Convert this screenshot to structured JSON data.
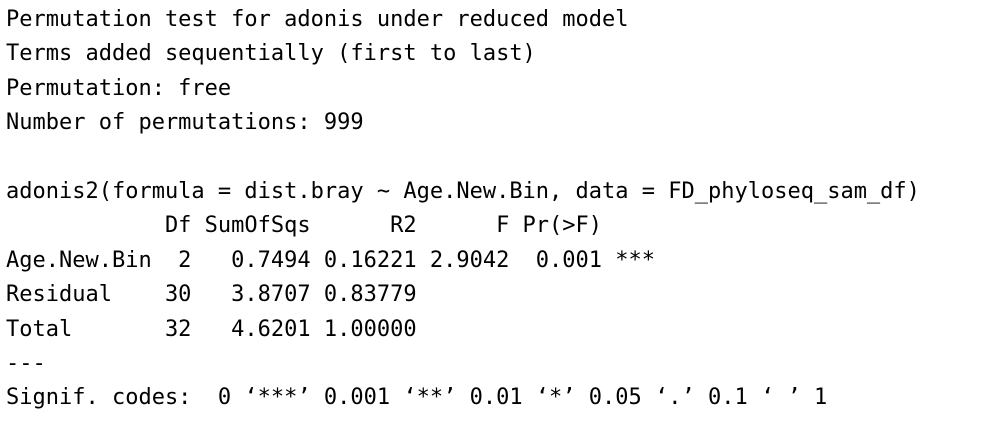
{
  "output": {
    "header": {
      "title": "Permutation test for adonis under reduced model",
      "terms": "Terms added sequentially (first to last)",
      "permutation": "Permutation: free",
      "n_permutations": "Number of permutations: 999"
    },
    "call": "adonis2(formula = dist.bray ~ Age.New.Bin, data = FD_phyloseq_sam_df)",
    "table": {
      "header_row": "            Df SumOfSqs      R2      F Pr(>F)    ",
      "rows": [
        "Age.New.Bin  2   0.7494 0.16221 2.9042  0.001 ***",
        "Residual    30   3.8707 0.83779              ",
        "Total       32   4.6201 1.00000              "
      ]
    },
    "separator": "---",
    "signif_codes": "Signif. codes:  0 ‘***’ 0.001 ‘**’ 0.01 ‘*’ 0.05 ‘.’ 0.1 ‘ ’ 1"
  }
}
